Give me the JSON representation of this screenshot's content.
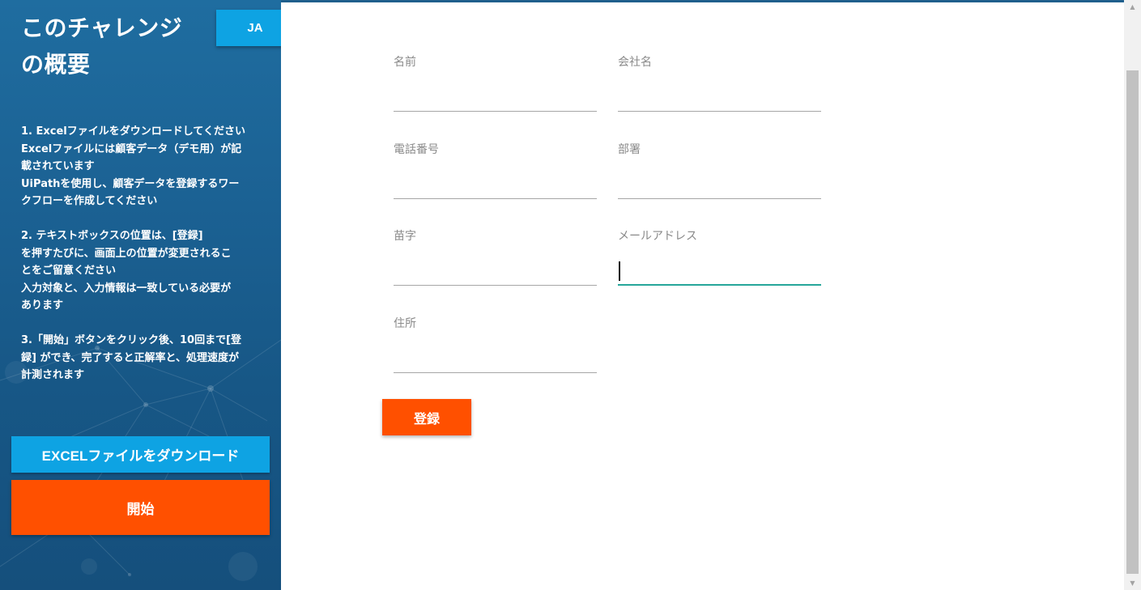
{
  "sidebar": {
    "title_line1": "このチャレンジ",
    "title_line2": "の概要",
    "language_button": "JA",
    "instructions": [
      [
        "1. Excelファイルをダウンロードしてください",
        "Excelファイルには顧客データ（デモ用）が記",
        "載されています",
        "UiPathを使用し、顧客データを登録するワー",
        "クフローを作成してください"
      ],
      [
        "2. テキストボックスの位置は、[登録]",
        "を押すたびに、画面上の位置が変更されるこ",
        "とをご留意ください",
        "入力対象と、入力情報は一致している必要が",
        "あります"
      ],
      [
        "3.「開始」ボタンをクリック後、10回まで[登",
        "録] ができ、完了すると正解率と、処理速度が",
        "計測されます"
      ]
    ],
    "download_button": "EXCELファイルをダウンロード",
    "start_button": "開始"
  },
  "form": {
    "fields": {
      "name": {
        "label": "名前",
        "value": ""
      },
      "company": {
        "label": "会社名",
        "value": ""
      },
      "phone": {
        "label": "電話番号",
        "value": ""
      },
      "department": {
        "label": "部署",
        "value": ""
      },
      "surname": {
        "label": "苗字",
        "value": ""
      },
      "email": {
        "label": "メールアドレス",
        "value": ""
      },
      "address": {
        "label": "住所",
        "value": ""
      }
    },
    "submit_button": "登録"
  },
  "colors": {
    "sidebar_bg": "#1b6193",
    "accent_blue": "#0ea3e3",
    "accent_orange": "#ff5000",
    "focus_teal": "#26a69a"
  },
  "icons": {
    "scroll_up": "scroll-up-arrow-icon",
    "scroll_down": "scroll-down-arrow-icon"
  }
}
